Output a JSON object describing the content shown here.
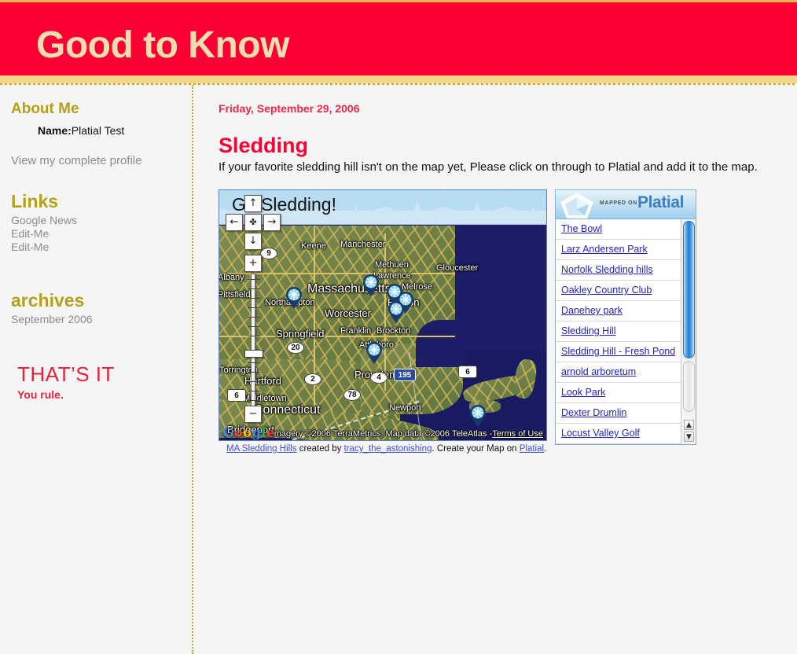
{
  "header": {
    "title": "Good to Know"
  },
  "sidebar": {
    "about_heading": "About Me",
    "name_label": "Name:",
    "name_value": "Platial Test",
    "profile_link": "View my complete profile",
    "links_heading": "Links",
    "links": [
      "Google News",
      "Edit-Me",
      "Edit-Me"
    ],
    "archives_heading": "archives",
    "archives": [
      "September 2006"
    ],
    "thats_it": "THAT’S IT",
    "you_rule": "You rule."
  },
  "post": {
    "date": "Friday, September 29, 2006",
    "title": "Sledding",
    "body": "If your favorite sledding hill isn't on the map yet, Please click on through to Platial and add it to the map."
  },
  "map": {
    "banner_title": "Go Sledding!",
    "attribution": "Imagery ©2006 TerraMetrics, Map data ©2006 TeleAtlas -",
    "terms_link": "Terms of Use",
    "google_logo": {
      "g1": "G",
      "o1": "o",
      "o2": "o",
      "g2": "g",
      "l": "l",
      "e": "e"
    },
    "controls": {
      "up": "↑",
      "down": "↓",
      "left": "←",
      "right": "→",
      "center": "✤",
      "zoom_in": "+",
      "zoom_out": "−"
    },
    "labels": [
      "Keene",
      "Manchester",
      "Methuen",
      "Lawrence",
      "Gloucester",
      "Massachusetts",
      "Melrose",
      "Boston",
      "Northampton",
      "Worcester",
      "Springfield",
      "Franklin",
      "Brockton",
      "Attleboro",
      "Pittsfield",
      "Torrington",
      "Hartford",
      "Middletown",
      "Connecticut",
      "Providence",
      "Newport",
      "Bridgeport",
      "Albany"
    ],
    "route_shields": [
      "9",
      "20",
      "2",
      "4",
      "78",
      "6",
      "6",
      "195"
    ],
    "caption": {
      "map_name": "MA Sledding Hills",
      "created_by_text": "created by",
      "author": "tracy_the_astonishing",
      "tail_text": ". Create your Map on ",
      "platial_link": "Platial",
      "period": "."
    }
  },
  "platial": {
    "mapped_on": "MAPPED ON",
    "wordmark": "Platial",
    "places": [
      "The Bowl",
      "Larz Andersen Park",
      "Norfolk Sledding hills",
      "Oakley Country Club",
      "Danehey park",
      "Sledding Hill",
      "Sledding Hill - Fresh Pond",
      "arnold arboretum",
      "Look Park",
      "Dexter Drumlin",
      "Locust Valley Golf"
    ],
    "scroll_up": "▲",
    "scroll_down": "▼"
  },
  "colors": {
    "header_red": "#fb0034",
    "header_text": "#f2ddae",
    "gold": "#b5a01c",
    "post_red": "#fb0034",
    "link_blue": "#2323c8"
  }
}
